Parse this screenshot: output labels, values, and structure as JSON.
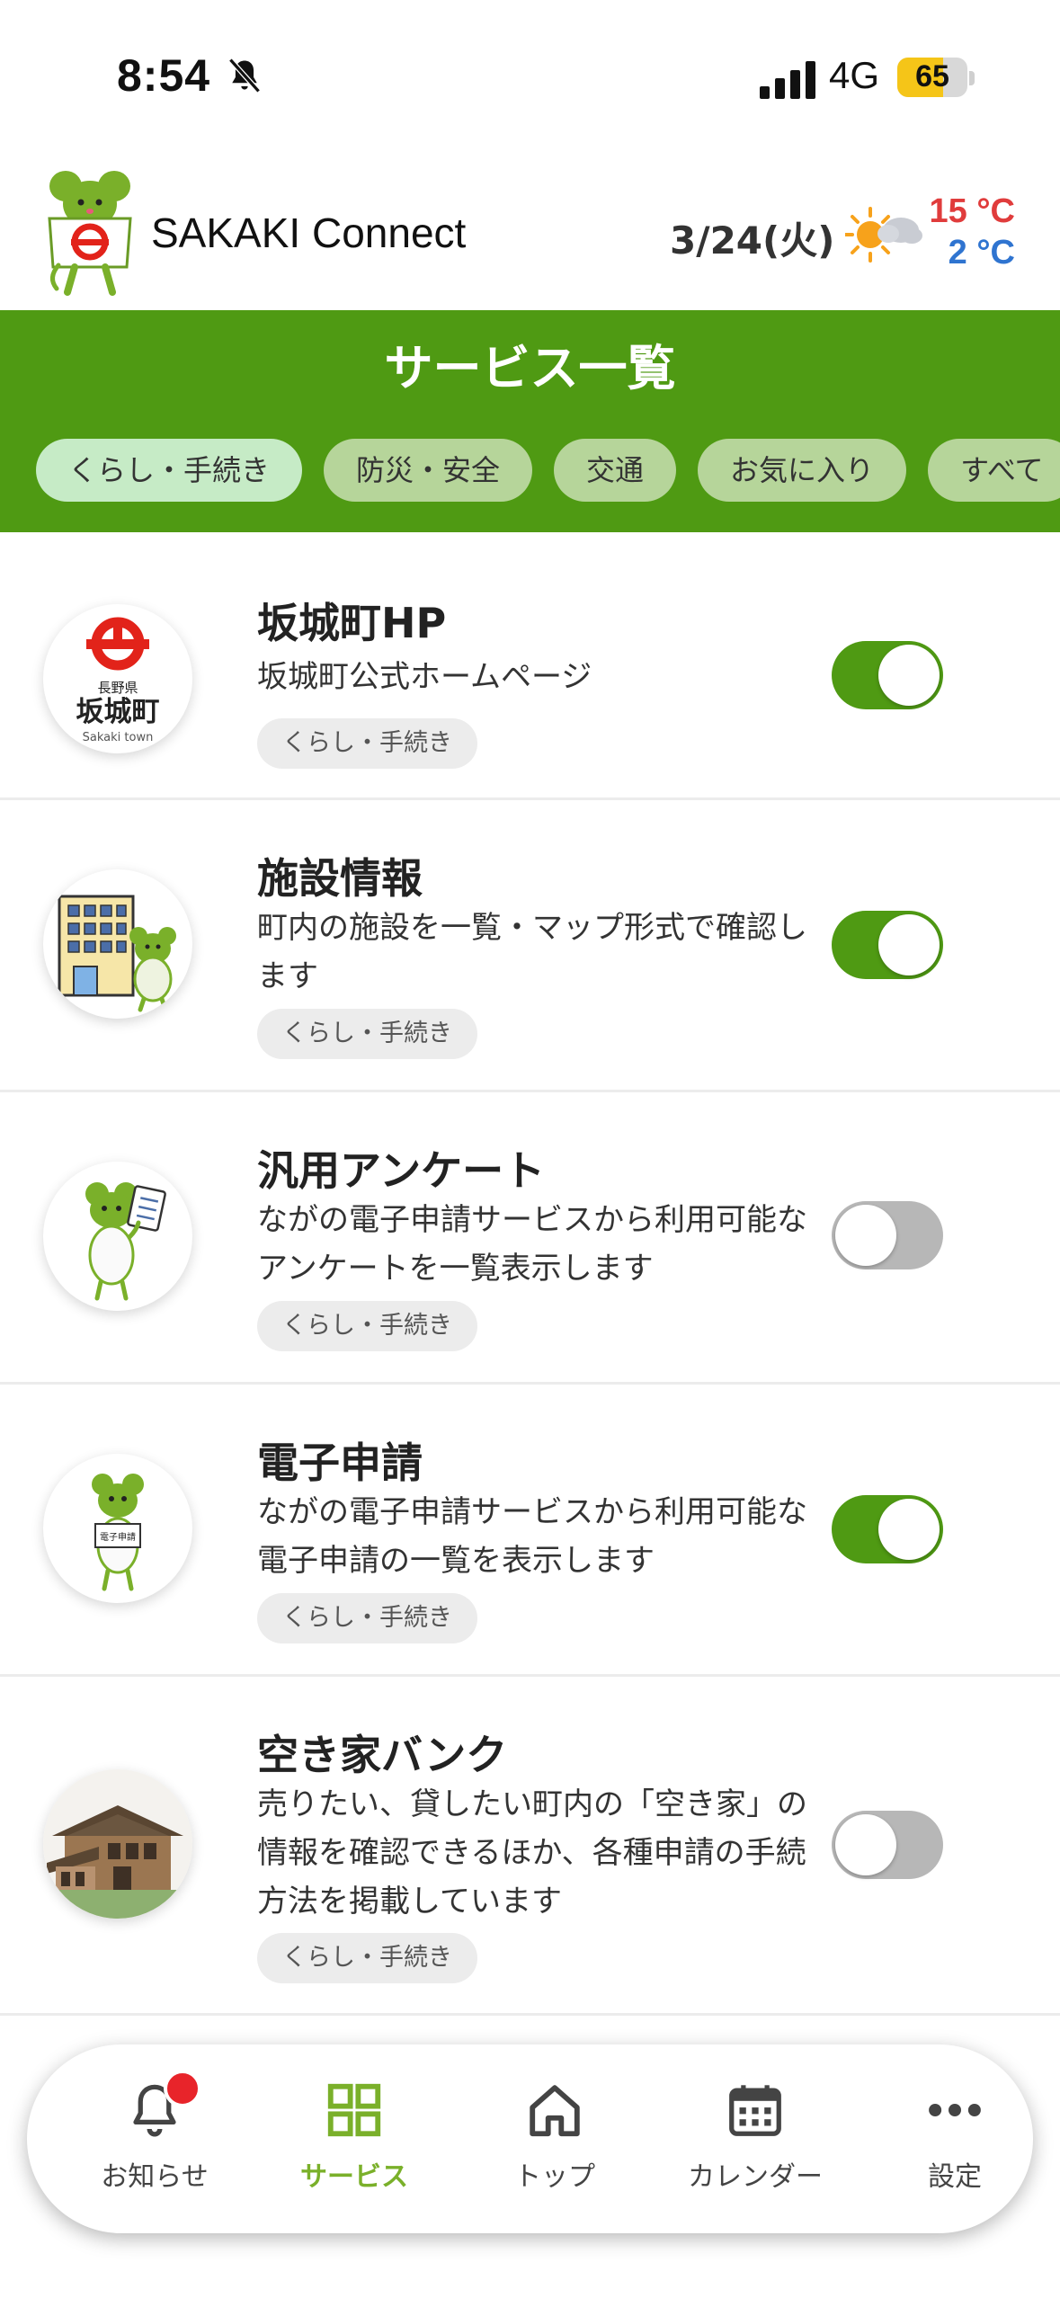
{
  "status_bar": {
    "time": "8:54",
    "network": "4G",
    "battery": "65",
    "battery_level": 0.65
  },
  "header": {
    "app_title": "SAKAKI Connect",
    "date": "3/24(火)",
    "temp_high": "15 °C",
    "temp_low": "2 °C"
  },
  "services": {
    "title": "サービス一覧",
    "tabs": [
      {
        "label": "くらし・手続き",
        "active": true
      },
      {
        "label": "防災・安全",
        "active": false
      },
      {
        "label": "交通",
        "active": false
      },
      {
        "label": "お気に入り",
        "active": false
      },
      {
        "label": "すべて",
        "active": false
      }
    ],
    "items": [
      {
        "title": "坂城町HP",
        "desc": "坂城町公式ホームページ",
        "tag": "くらし・手続き",
        "enabled": true,
        "icon": "town-emblem-icon",
        "logo_text": "長野県",
        "logo_text2": "坂城町",
        "logo_text3": "Sakaki town"
      },
      {
        "title": "施設情報",
        "desc": "町内の施設を一覧・マップ形式で確認します",
        "tag": "くらし・手続き",
        "enabled": true,
        "icon": "building-mascot-icon"
      },
      {
        "title": "汎用アンケート",
        "desc": "ながの電子申請サービスから利用可能なアンケートを一覧表示します",
        "tag": "くらし・手続き",
        "enabled": false,
        "icon": "clipboard-mascot-icon"
      },
      {
        "title": "電子申請",
        "desc": "ながの電子申請サービスから利用可能な電子申請の一覧を表示します",
        "tag": "くらし・手続き",
        "enabled": true,
        "icon": "application-mascot-icon",
        "sign_text": "電子申請"
      },
      {
        "title": "空き家バンク",
        "desc": "売りたい、貸したい町内の「空き家」の情報を確認できるほか、各種申請の手続方法を掲載しています",
        "tag": "くらし・手続き",
        "enabled": false,
        "icon": "vacant-house-icon"
      }
    ]
  },
  "bottom_nav": [
    {
      "label": "お知らせ",
      "icon": "bell-icon",
      "active": false,
      "badge": true
    },
    {
      "label": "サービス",
      "icon": "grid-icon",
      "active": true
    },
    {
      "label": "トップ",
      "icon": "home-icon",
      "active": false
    },
    {
      "label": "カレンダー",
      "icon": "calendar-icon",
      "active": false
    },
    {
      "label": "設定",
      "icon": "more-icon",
      "active": false
    }
  ],
  "colors": {
    "brand_green": "#4f9a13",
    "tab_bg": "#b6d59a",
    "tab_active_bg": "#c6ebc6",
    "nav_active": "#7ab02a",
    "temp_high": "#e03c3c",
    "temp_low": "#2f74d0",
    "badge": "#e8242a"
  }
}
